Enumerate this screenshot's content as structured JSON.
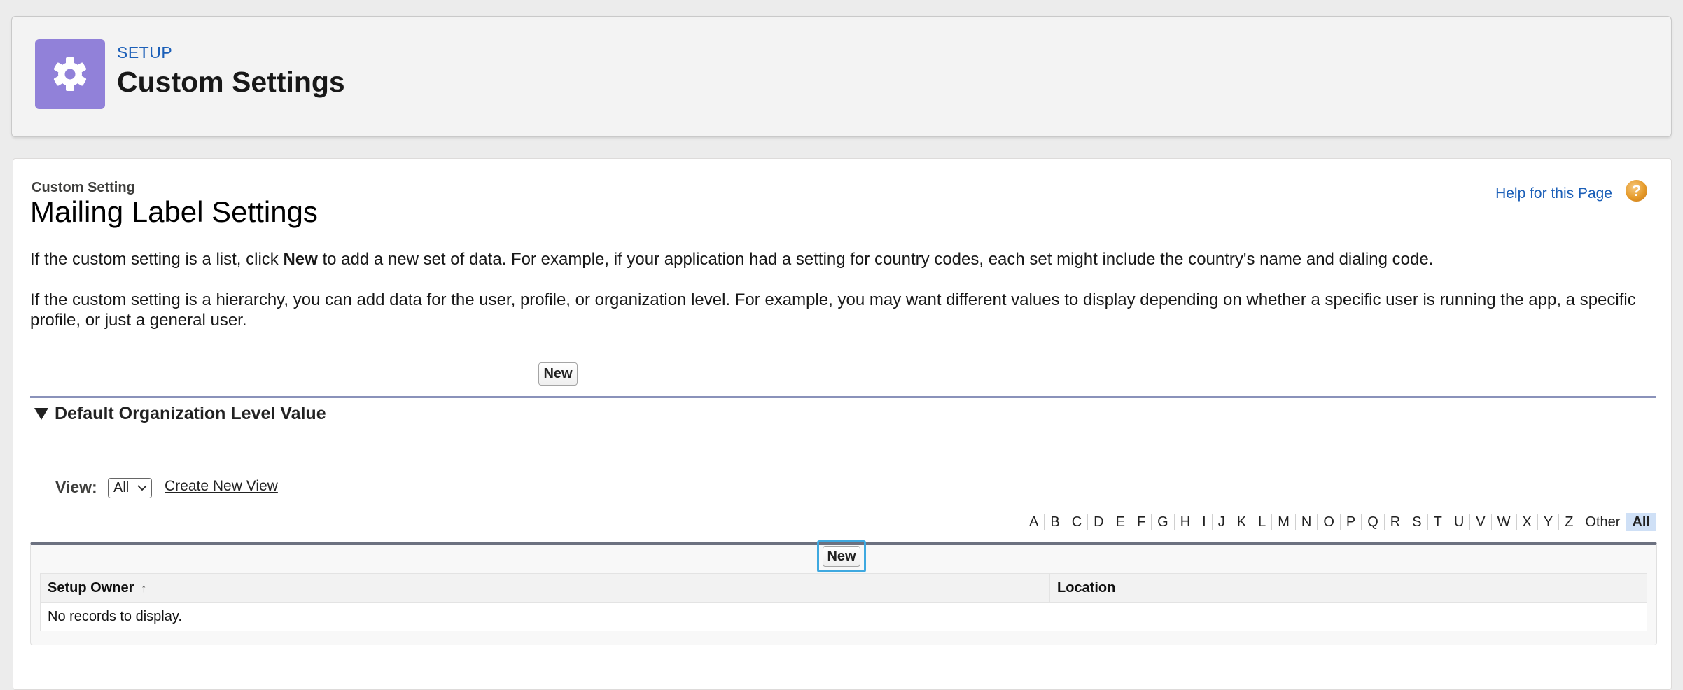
{
  "header": {
    "eyebrow": "SETUP",
    "title": "Custom Settings",
    "icon": "gear-icon"
  },
  "page": {
    "crumb": "Custom Setting",
    "title": "Mailing Label Settings",
    "help_link": "Help for this Page",
    "help_icon_glyph": "?",
    "para1_before": "If the custom setting is a list, click ",
    "para1_bold": "New",
    "para1_after": " to add a new set of data. For example, if your application had a setting for country codes, each set might include the country's name and dialing code.",
    "para2": "If the custom setting is a hierarchy, you can add data for the user, profile, or organization level. For example, you may want different values to display depending on whether a specific user is running the app, a specific profile, or just a general user.",
    "new_button": "New"
  },
  "section": {
    "title": "Default Organization Level Value"
  },
  "view": {
    "label": "View:",
    "selected": "All",
    "create_link": "Create New View"
  },
  "alpha": {
    "letters": [
      "A",
      "B",
      "C",
      "D",
      "E",
      "F",
      "G",
      "H",
      "I",
      "J",
      "K",
      "L",
      "M",
      "N",
      "O",
      "P",
      "Q",
      "R",
      "S",
      "T",
      "U",
      "V",
      "W",
      "X",
      "Y",
      "Z",
      "Other",
      "All"
    ],
    "active": "All"
  },
  "list": {
    "new_button": "New",
    "columns": [
      "Setup Owner",
      "Location"
    ],
    "sort_glyph": "↑",
    "empty_text": "No records to display."
  },
  "colors": {
    "accent_icon": "#9181d9",
    "link": "#1b5fb8",
    "focus": "#3fa9e0"
  }
}
